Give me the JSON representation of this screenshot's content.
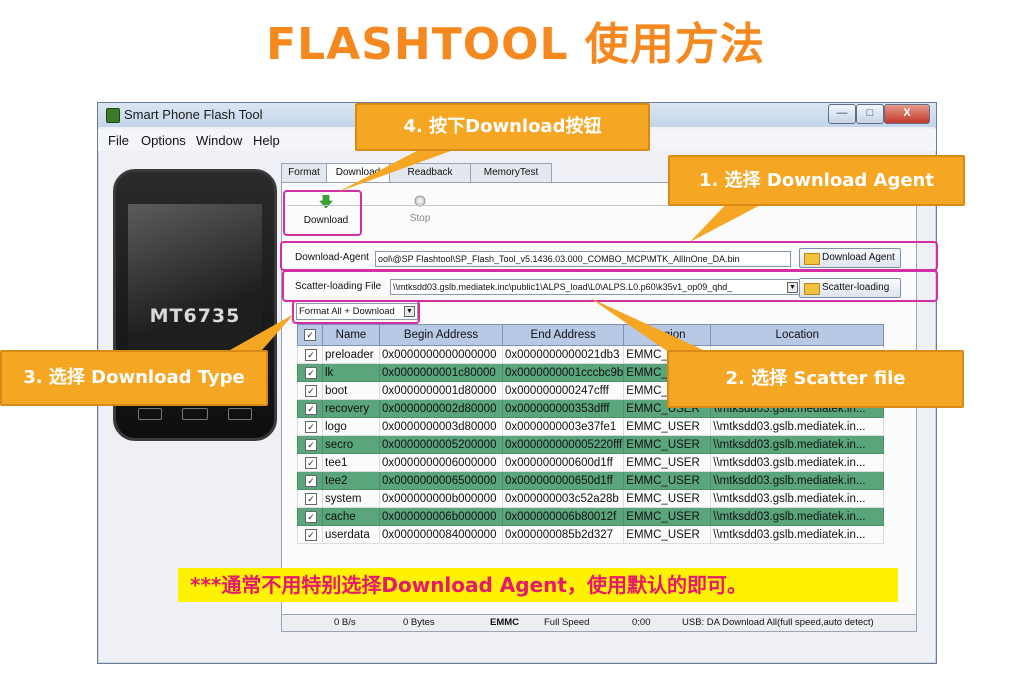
{
  "slide": {
    "title": "FLASHTOOL 使用方法",
    "note": "***通常不用特别选择Download Agent，使用默认的即可。"
  },
  "callouts": {
    "step1": "1. 选择 Download Agent",
    "step2": "2. 选择 Scatter file",
    "step3": "3. 选择 Download Type",
    "step4": "4. 按下Download按钮"
  },
  "window": {
    "title": "Smart Phone Flash Tool",
    "menu": [
      "File",
      "Options",
      "Window",
      "Help"
    ],
    "controls": {
      "minimize": "—",
      "maximize": "□",
      "close": "X"
    }
  },
  "phone": {
    "model": "MT6735"
  },
  "tabs": [
    "Format",
    "Download",
    "Readback",
    "MemoryTest"
  ],
  "toolbar": {
    "download_label": "Download",
    "stop_label": "Stop"
  },
  "fields": {
    "download_agent_label": "Download-Agent",
    "download_agent_path": "ool\\@SP Flashtool\\SP_Flash_Tool_v5.1436.03.000_COMBO_MCP\\MTK_AllInOne_DA.bin",
    "download_agent_button": "Download Agent",
    "scatter_label": "Scatter-loading File",
    "scatter_path": "\\\\mtksdd03.gslb.mediatek.inc\\public1\\ALPS_load\\L0\\ALPS.L0.p60\\k35v1_op09_qhd_",
    "scatter_button": "Scatter-loading",
    "download_type": "Format All + Download"
  },
  "table": {
    "headers": [
      "Name",
      "Begin Address",
      "End Address",
      "Region",
      "Location"
    ],
    "rows": [
      {
        "checked": true,
        "name": "preloader",
        "begin": "0x0000000000000000",
        "end": "0x0000000000021db3",
        "region": "EMMC_B",
        "location": "",
        "green": false
      },
      {
        "checked": true,
        "name": "lk",
        "begin": "0x0000000001c80000",
        "end": "0x0000000001cccbc9b",
        "region": "EMMC_U",
        "location": "",
        "green": true
      },
      {
        "checked": true,
        "name": "boot",
        "begin": "0x0000000001d80000",
        "end": "0x000000000247cfff",
        "region": "EMMC_U",
        "location": "",
        "green": false
      },
      {
        "checked": true,
        "name": "recovery",
        "begin": "0x0000000002d80000",
        "end": "0x000000000353dfff",
        "region": "EMMC_USER",
        "location": "\\\\mtksdd03.gslb.mediatek.in...",
        "green": true
      },
      {
        "checked": true,
        "name": "logo",
        "begin": "0x0000000003d80000",
        "end": "0x0000000003e37fe1",
        "region": "EMMC_USER",
        "location": "\\\\mtksdd03.gslb.mediatek.in...",
        "green": false
      },
      {
        "checked": true,
        "name": "secro",
        "begin": "0x0000000005200000",
        "end": "0x000000000005220fff",
        "region": "EMMC_USER",
        "location": "\\\\mtksdd03.gslb.mediatek.in...",
        "green": true
      },
      {
        "checked": true,
        "name": "tee1",
        "begin": "0x0000000006000000",
        "end": "0x000000000600d1ff",
        "region": "EMMC_USER",
        "location": "\\\\mtksdd03.gslb.mediatek.in...",
        "green": false
      },
      {
        "checked": true,
        "name": "tee2",
        "begin": "0x0000000006500000",
        "end": "0x000000000650d1ff",
        "region": "EMMC_USER",
        "location": "\\\\mtksdd03.gslb.mediatek.in...",
        "green": true
      },
      {
        "checked": true,
        "name": "system",
        "begin": "0x000000000b000000",
        "end": "0x000000003c52a28b",
        "region": "EMMC_USER",
        "location": "\\\\mtksdd03.gslb.mediatek.in...",
        "green": false
      },
      {
        "checked": true,
        "name": "cache",
        "begin": "0x000000006b000000",
        "end": "0x000000006b80012f",
        "region": "EMMC_USER",
        "location": "\\\\mtksdd03.gslb.mediatek.in...",
        "green": true
      },
      {
        "checked": true,
        "name": "userdata",
        "begin": "0x0000000084000000",
        "end": "0x000000085b2d327",
        "region": "EMMC_USER",
        "location": "\\\\mtksdd03.gslb.mediatek.in...",
        "green": false
      }
    ]
  },
  "status": {
    "speed": "0 B/s",
    "bytes": "0 Bytes",
    "storage": "EMMC",
    "mode": "Full Speed",
    "time": "0:00",
    "usb": "USB: DA Download All(full speed,auto detect)"
  },
  "colors": {
    "accent": "#f5891f",
    "callout": "#f5a623",
    "highlight": "#d32ea5",
    "row_green": "#5aa57b",
    "note_bg": "#fff200",
    "note_text": "#e6186f"
  }
}
